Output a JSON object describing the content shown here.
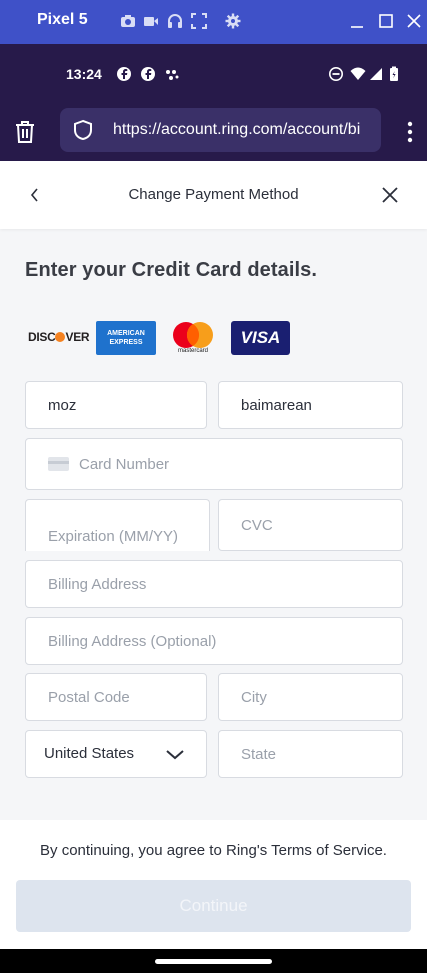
{
  "emulator": {
    "title": "Pixel 5",
    "bar_color": "#3f51c8"
  },
  "status_bar": {
    "time": "13:24"
  },
  "browser": {
    "url": "https://account.ring.com/account/bi"
  },
  "modal": {
    "title": "Change Payment Method"
  },
  "form": {
    "heading": "Enter your Credit Card details.",
    "card_brands": {
      "discover": "DISC",
      "discover_tail": "VER",
      "amex_line1": "AMERICAN",
      "amex_line2": "EXPRESS",
      "mastercard": "mastercard",
      "visa": "VISA"
    },
    "first_name": "moz",
    "last_name": "baimarean",
    "card_number_placeholder": "Card Number",
    "expiration_placeholder": "Expiration (MM/YY)",
    "cvc_placeholder": "CVC",
    "billing_address_placeholder": "Billing Address",
    "billing_address_optional_placeholder": "Billing Address (Optional)",
    "postal_code_placeholder": "Postal Code",
    "city_placeholder": "City",
    "country": "United States",
    "state_placeholder": "State"
  },
  "footer": {
    "terms": "By continuing, you agree to Ring's Terms of Service.",
    "continue_label": "Continue"
  },
  "colors": {
    "brand_purple": "#271a4a",
    "continue_disabled": "#dde4ee",
    "amex_blue": "#1f72cd",
    "visa_navy": "#1a1f71"
  }
}
